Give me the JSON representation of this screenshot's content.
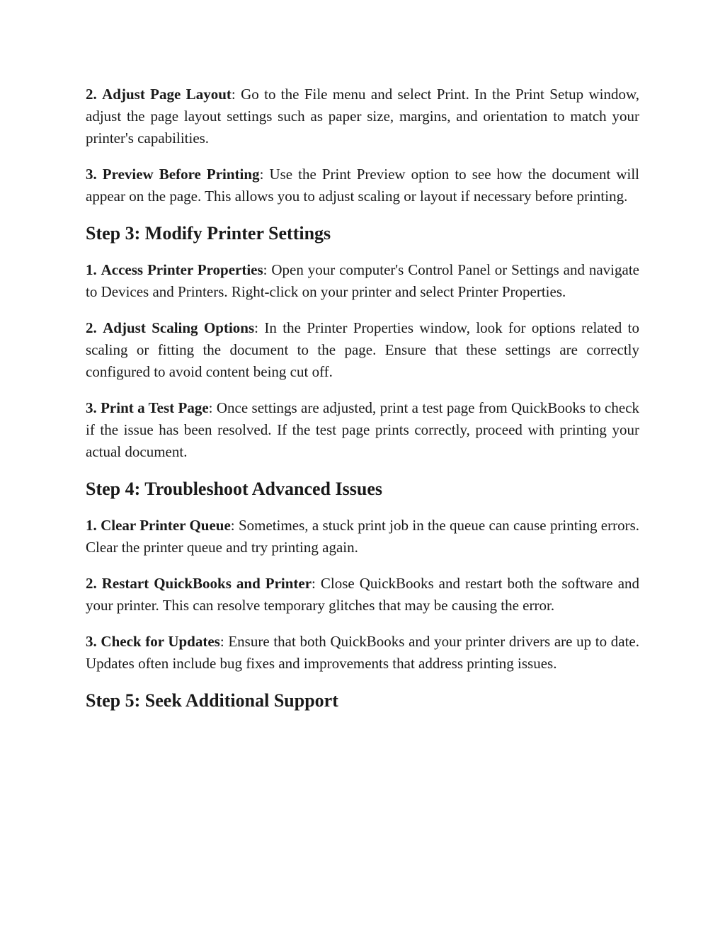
{
  "sections": [
    {
      "heading": null,
      "items": [
        {
          "number": "2.",
          "title": "Adjust Page Layout",
          "text": "Go to the File menu and select Print. In the Print Setup window, adjust the page layout settings such as paper size, margins, and orientation to match your printer's capabilities."
        },
        {
          "number": "3.",
          "title": "Preview Before Printing",
          "text": "Use the Print Preview option to see how the document will appear on the page. This allows you to adjust scaling or layout if necessary before printing."
        }
      ]
    },
    {
      "heading": "Step 3: Modify Printer Settings",
      "items": [
        {
          "number": "1.",
          "title": "Access Printer Properties",
          "text": "Open your computer's Control Panel or Settings and navigate to Devices and Printers. Right-click on your printer and select Printer Properties."
        },
        {
          "number": "2.",
          "title": "Adjust Scaling Options",
          "text": "In the Printer Properties window, look for options related to scaling or fitting the document to the page. Ensure that these settings are correctly configured to avoid content being cut off."
        },
        {
          "number": "3.",
          "title": "Print a Test Page",
          "text": "Once settings are adjusted, print a test page from QuickBooks to check if the issue has been resolved. If the test page prints correctly, proceed with printing your actual document."
        }
      ]
    },
    {
      "heading": "Step 4: Troubleshoot Advanced Issues",
      "items": [
        {
          "number": "1.",
          "title": "Clear Printer Queue",
          "text": "Sometimes, a stuck print job in the queue can cause printing errors. Clear the printer queue and try printing again."
        },
        {
          "number": "2.",
          "title": "Restart QuickBooks and Printer",
          "text": "Close QuickBooks and restart both the software and your printer. This can resolve temporary glitches that may be causing the error."
        },
        {
          "number": "3.",
          "title": "Check for Updates",
          "text": "Ensure that both QuickBooks and your printer drivers are up to date. Updates often include bug fixes and improvements that address printing issues."
        }
      ]
    },
    {
      "heading": "Step 5: Seek Additional Support",
      "items": []
    }
  ],
  "separator": ": "
}
